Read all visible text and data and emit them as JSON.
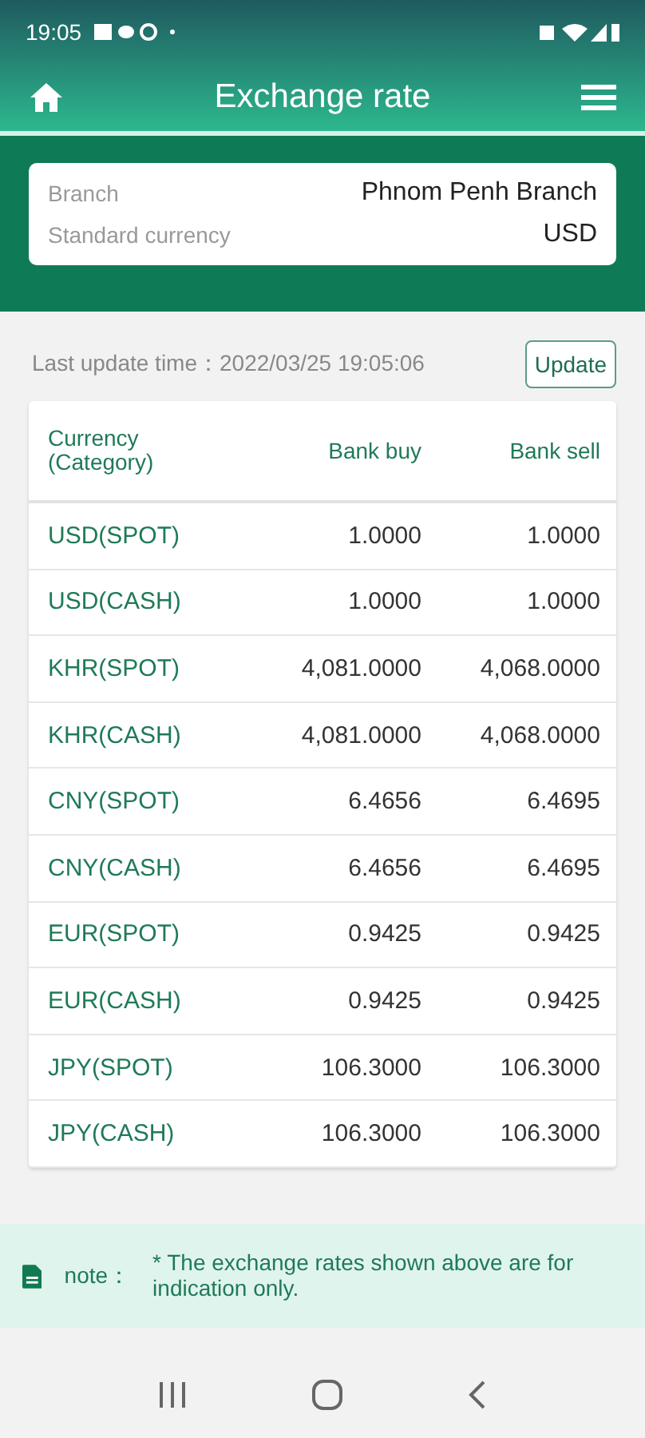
{
  "status_bar": {
    "time": "19:05"
  },
  "header": {
    "title": "Exchange rate"
  },
  "info": [
    {
      "label": "Branch",
      "value": "Phnom Penh Branch"
    },
    {
      "label": "Standard currency",
      "value": "USD"
    }
  ],
  "last_update": {
    "label": "Last update time：2022/03/25 19:05:06",
    "button": "Update"
  },
  "table": {
    "columns": [
      "Currency\n(Category)",
      "Bank buy",
      "Bank sell"
    ],
    "rows": [
      {
        "currency": "USD(SPOT)",
        "buy": "1.0000",
        "sell": "1.0000"
      },
      {
        "currency": "USD(CASH)",
        "buy": "1.0000",
        "sell": "1.0000"
      },
      {
        "currency": "KHR(SPOT)",
        "buy": "4,081.0000",
        "sell": "4,068.0000"
      },
      {
        "currency": "KHR(CASH)",
        "buy": "4,081.0000",
        "sell": "4,068.0000"
      },
      {
        "currency": "CNY(SPOT)",
        "buy": "6.4656",
        "sell": "6.4695"
      },
      {
        "currency": "CNY(CASH)",
        "buy": "6.4656",
        "sell": "6.4695"
      },
      {
        "currency": "EUR(SPOT)",
        "buy": "0.9425",
        "sell": "0.9425"
      },
      {
        "currency": "EUR(CASH)",
        "buy": "0.9425",
        "sell": "0.9425"
      },
      {
        "currency": "JPY(SPOT)",
        "buy": "106.3000",
        "sell": "106.3000"
      },
      {
        "currency": "JPY(CASH)",
        "buy": "106.3000",
        "sell": "106.3000"
      }
    ]
  },
  "note": {
    "label": "note：",
    "text": "* The exchange rates shown above are for indication only."
  }
}
